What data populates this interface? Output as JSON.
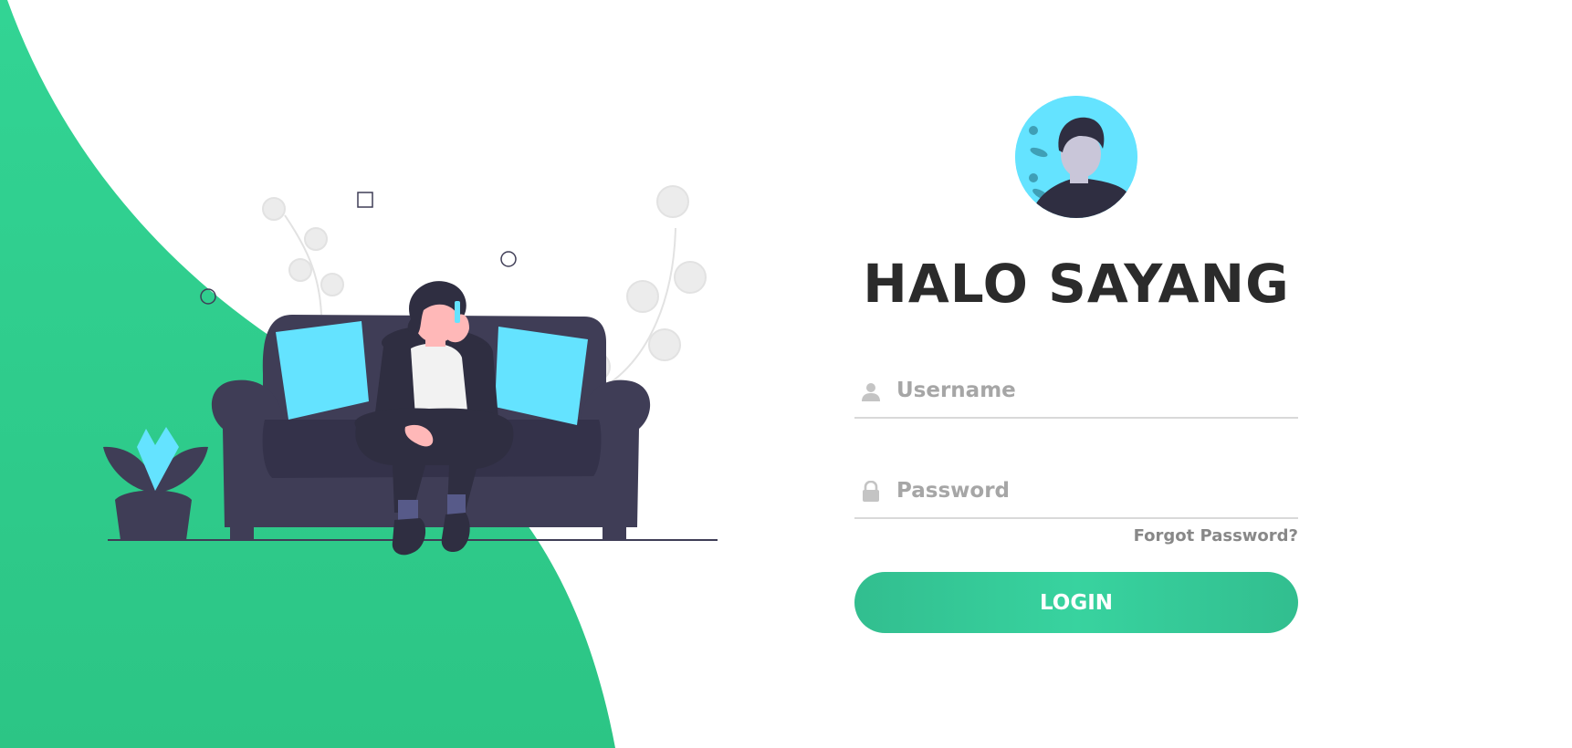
{
  "colors": {
    "accent": "#38d39f",
    "accent_dark": "#32be8f",
    "sofa": "#3f3d56",
    "cushion": "#64e3ff",
    "title_text": "#2b2b2b",
    "placeholder_text": "#a6a6a6",
    "link_text": "#888888"
  },
  "illustration": {
    "subject": "person-on-sofa-phone-illustration"
  },
  "login": {
    "avatar_icon": "user-avatar-icon",
    "title": "HALO SAYANG",
    "username": {
      "icon": "user-icon",
      "placeholder": "Username",
      "value": ""
    },
    "password": {
      "icon": "lock-icon",
      "placeholder": "Password",
      "value": ""
    },
    "forgot_password": "Forgot Password?",
    "login_button": "LOGIN"
  }
}
